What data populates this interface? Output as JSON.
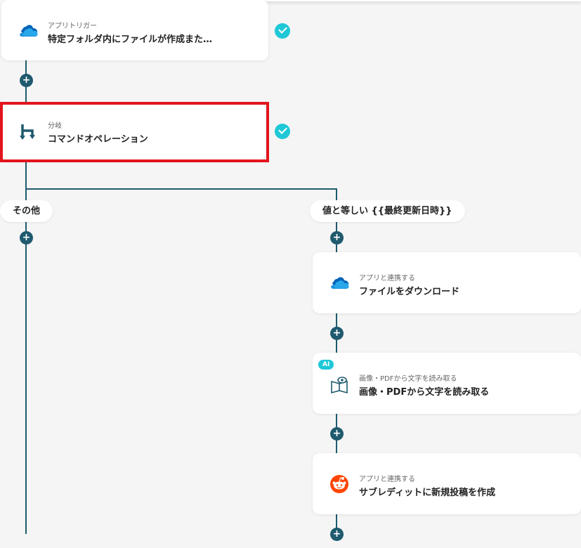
{
  "nodes": [
    {
      "sub": "アプリトリガー",
      "title": "特定フォルダ内にファイルが作成また…",
      "icon": "onedrive-icon"
    },
    {
      "sub": "分岐",
      "title": "コマンドオペレーション",
      "icon": "branch-icon"
    },
    {
      "sub": "アプリと連携する",
      "title": "ファイルをダウンロード",
      "icon": "onedrive-icon"
    },
    {
      "sub": "画像・PDFから文字を読み取る",
      "title": "画像・PDFから文字を読み取る",
      "icon": "ocr-book-icon",
      "badge": "AI"
    },
    {
      "sub": "アプリと連携する",
      "title": "サブレディットに新規投稿を作成",
      "icon": "reddit-icon"
    }
  ],
  "branches": {
    "left": "その他",
    "right": "値と等しい {{最終更新日時}}"
  },
  "plus_label": "+",
  "colors": {
    "line": "#1f5a6e",
    "check": "#1ec8d6",
    "highlight": "#e3151c",
    "background": "#f5f5f5"
  }
}
